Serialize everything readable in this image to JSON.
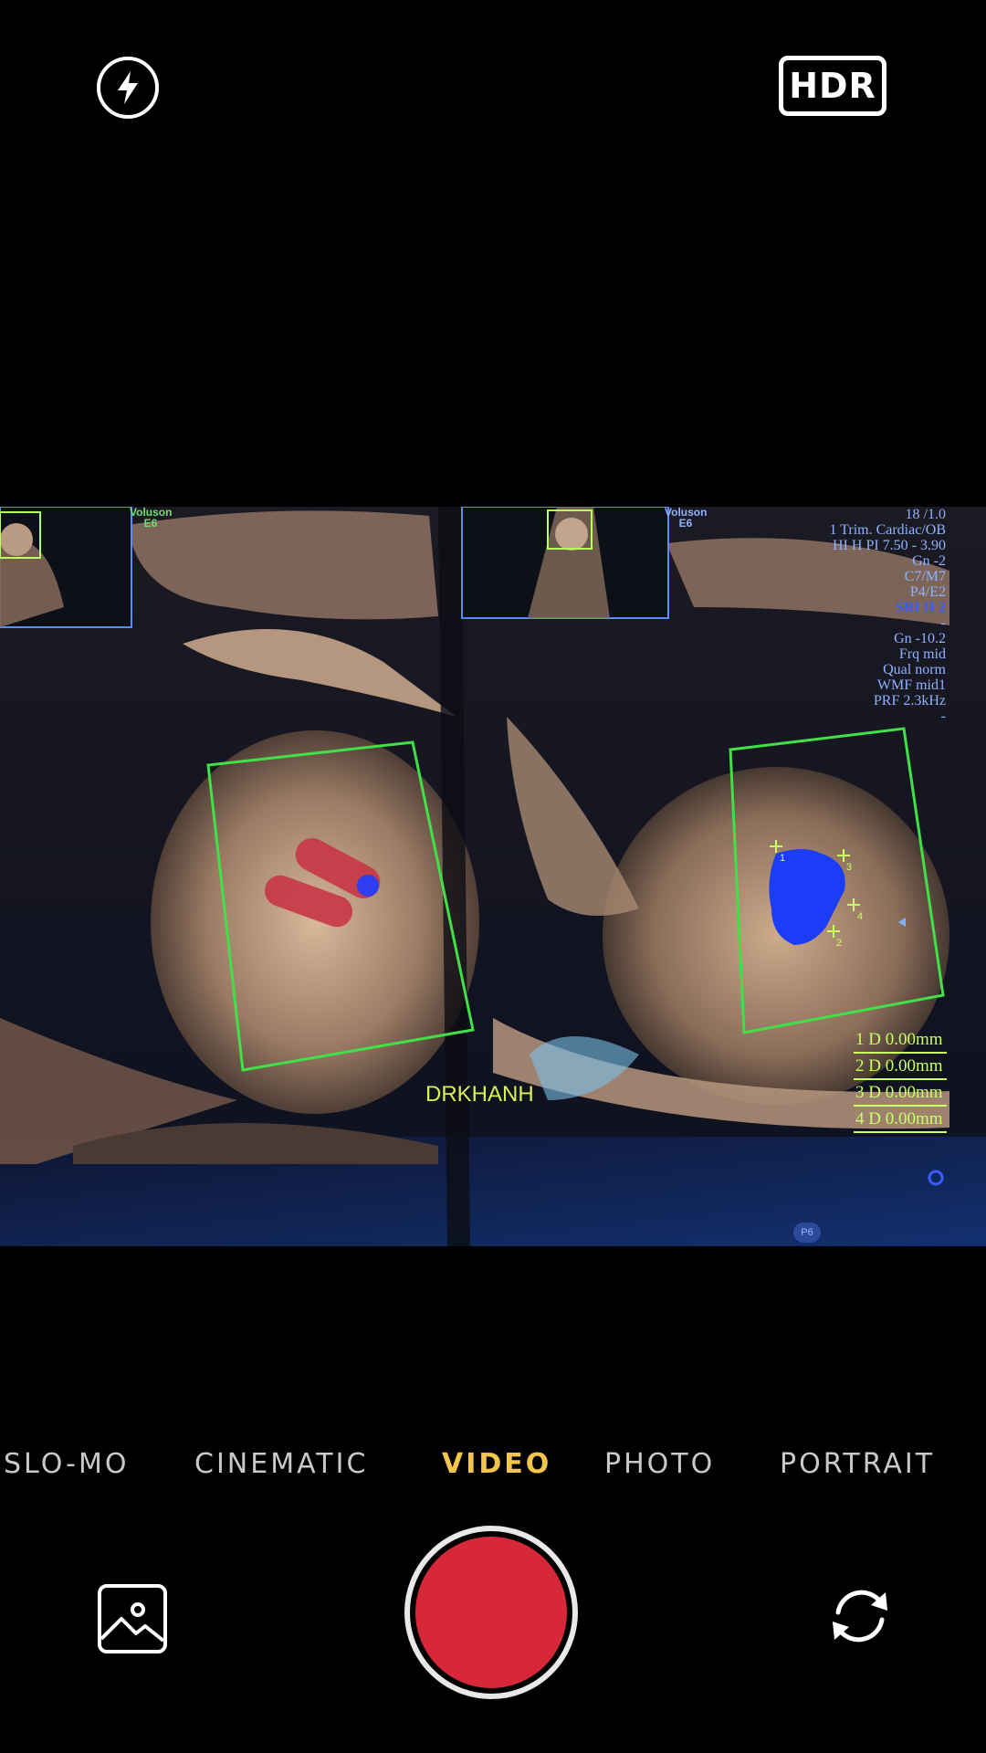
{
  "top_bar": {
    "flash_icon": "flash-bolt-icon",
    "hdr_label": "HDR"
  },
  "viewfinder": {
    "left_panel": {
      "brand_line1": "Voluson",
      "brand_line2": "E6"
    },
    "right_panel": {
      "brand_line1": "Voluson",
      "brand_line2": "E6"
    },
    "us_info": [
      "18 /1.0",
      "1 Trim. Cardiac/OB",
      "HI H PI 7.50 - 3.90",
      "Gn  -2",
      "C7/M7",
      "P4/E2",
      "SRI II 2",
      "-",
      "Gn -10.2",
      "Frq mid",
      "Qual norm",
      "WMF mid1",
      "PRF  2.3kHz",
      "-"
    ],
    "measurements": [
      "1 D 0.00mm",
      "2 D 0.00mm",
      "3 D 0.00mm",
      "4 D 0.00mm"
    ],
    "annotation": "DRKHANH",
    "page_badge": "P6",
    "caliper_labels": [
      "1",
      "3",
      "4",
      "2"
    ]
  },
  "modes": {
    "items": [
      "SLO-MO",
      "CINEMATIC",
      "VIDEO",
      "PHOTO",
      "PORTRAIT"
    ],
    "active": "VIDEO"
  },
  "controls": {
    "gallery_icon": "photo-gallery-icon",
    "shutter_icon": "record-shutter-icon",
    "switch_icon": "switch-camera-icon",
    "shutter_color": "#d7283a",
    "active_mode_color": "#f3c54b"
  }
}
